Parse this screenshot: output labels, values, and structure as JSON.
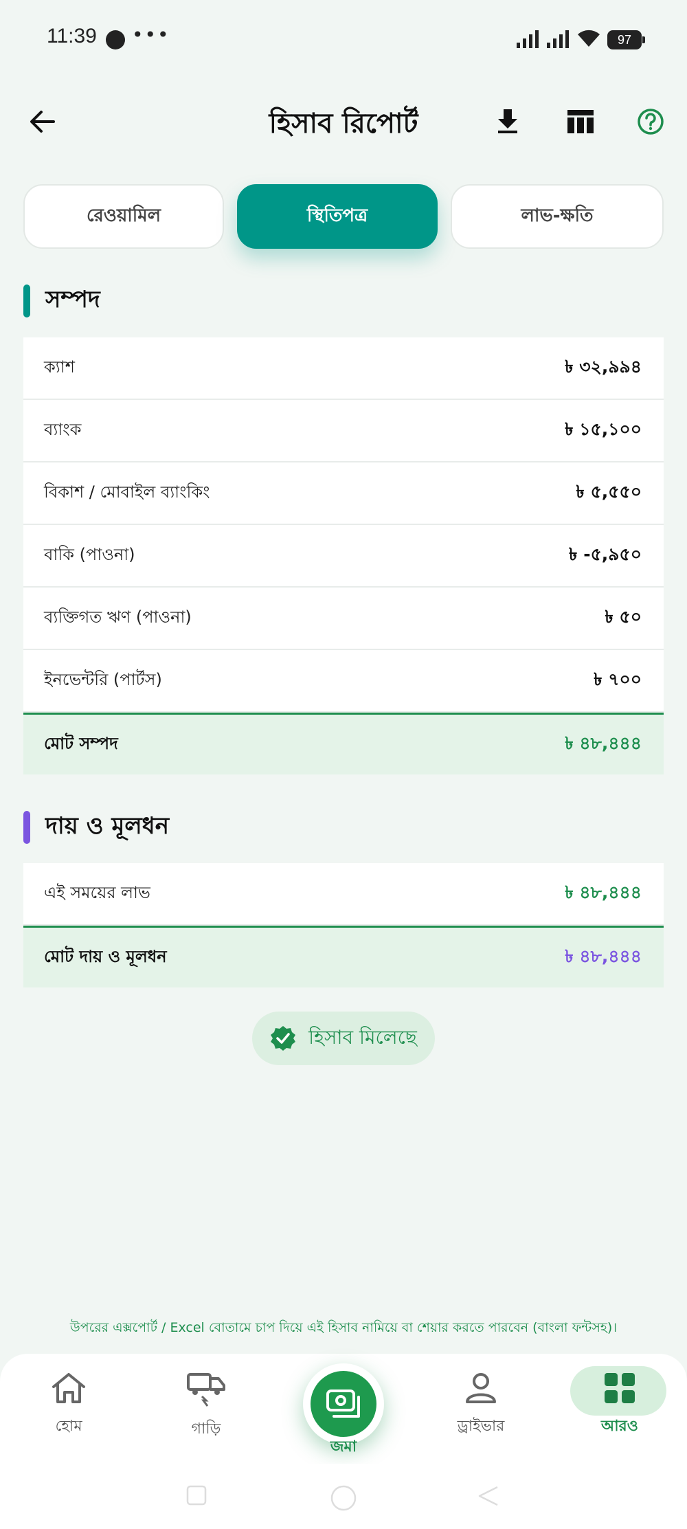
{
  "status_bar": {
    "time": "11:39",
    "dots": "•••",
    "battery": "97"
  },
  "header": {
    "title": "হিসাব রিপোর্ট"
  },
  "tabs": [
    {
      "label": "রেওয়ামিল",
      "active": false
    },
    {
      "label": "স্থিতিপত্র",
      "active": true
    },
    {
      "label": "লাভ-ক্ষতি",
      "active": false
    }
  ],
  "assets": {
    "title": "সম্পদ",
    "accent": "#009688",
    "rows": [
      {
        "label": "ক্যাশ",
        "value": "৳ ৩২,৯৯৪"
      },
      {
        "label": "ব্যাংক",
        "value": "৳ ১৫,১০০"
      },
      {
        "label": "বিকাশ / মোবাইল ব্যাংকিং",
        "value": "৳ ৫,৫৫০"
      },
      {
        "label": "বাকি (পাওনা)",
        "value": "৳ -৫,৯৫০"
      },
      {
        "label": "ব্যক্তিগত ঋণ (পাওনা)",
        "value": "৳ ৫০"
      },
      {
        "label": "ইনভেন্টরি (পার্টস)",
        "value": "৳ ৭০০"
      }
    ],
    "total": {
      "label": "মোট সম্পদ",
      "value": "৳ ৪৮,৪৪৪"
    }
  },
  "liabilities": {
    "title": "দায় ও মূলধন",
    "accent": "#7b55e0",
    "rows": [
      {
        "label": "এই সময়ের লাভ",
        "value": "৳ ৪৮,৪৪৪"
      }
    ],
    "total": {
      "label": "মোট দায় ও মূলধন",
      "value": "৳ ৪৮,৪৪৪"
    }
  },
  "balanced_badge": "হিসাব মিলেছে",
  "footnote": "উপরের এক্সপোর্ট / Excel বোতামে চাপ দিয়ে এই হিসাব নামিয়ে বা শেয়ার করতে পারবেন (বাংলা ফন্টসহ)।",
  "bottom_nav": {
    "home": "হোম",
    "vehicles": "গাড়ি",
    "deposit": "জমা",
    "driver": "ড্রাইভার",
    "more": "আরও"
  },
  "colors": {
    "primary": "#009688",
    "green": "#1e8e4e",
    "purple": "#7b55e0",
    "background": "#f1f6f3"
  }
}
